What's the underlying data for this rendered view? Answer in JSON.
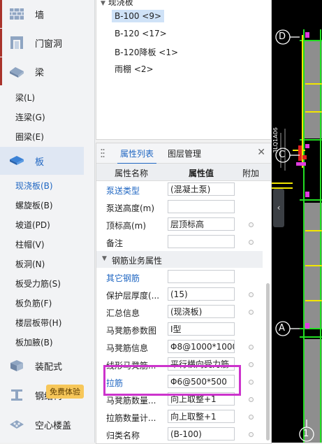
{
  "leftnav": {
    "categories": [
      {
        "label": "墙"
      },
      {
        "label": "门窗洞"
      },
      {
        "label": "梁"
      },
      {
        "label": "板"
      },
      {
        "label": "装配式"
      },
      {
        "label": "钢结构"
      },
      {
        "label": "空心楼盖"
      }
    ],
    "beam_items": [
      "梁(L)",
      "连梁(G)",
      "圈梁(E)"
    ],
    "slab_items": [
      "现浇板(B)",
      "螺旋板(B)",
      "坡道(PD)",
      "柱帽(V)",
      "板洞(N)",
      "板受力筋(S)",
      "板负筋(F)",
      "楼层板带(H)",
      "板加腋(B)"
    ],
    "badge": "免费体验"
  },
  "tree": {
    "root": "现浇板",
    "nodes": [
      "B-100 <9>",
      "B-120 <17>",
      "B-120降板 <1>",
      "雨棚 <2>"
    ]
  },
  "props": {
    "tab_props": "属性列表",
    "tab_layers": "图层管理",
    "close": "✕",
    "col_name": "属性名称",
    "col_value": "属性值",
    "col_add": "附加",
    "rows_top": [
      {
        "name": "泵送类型",
        "value": "(混凝土泵)",
        "link": true
      },
      {
        "name": "泵送高度(m)",
        "value": "",
        "link": false
      },
      {
        "name": "顶标高(m)",
        "value": "层顶标高",
        "link": false
      },
      {
        "name": "备注",
        "value": "",
        "link": false
      }
    ],
    "section": "钢筋业务属性",
    "rows_bottom": [
      {
        "name": "其它钢筋",
        "value": "",
        "link": true
      },
      {
        "name": "保护层厚度(...",
        "value": "(15)",
        "link": false
      },
      {
        "name": "汇总信息",
        "value": "(现浇板)",
        "link": false
      },
      {
        "name": "马凳筋参数图",
        "value": "Ⅰ型",
        "link": false
      },
      {
        "name": "马凳筋信息",
        "value": "Φ8@1000*1000",
        "link": false
      },
      {
        "name": "线形马凳筋...",
        "value": "平行横向受力筋",
        "link": false
      },
      {
        "name": "拉筋",
        "value": "Φ6@500*500",
        "link": true
      },
      {
        "name": "马凳筋数量...",
        "value": "向上取整+1",
        "link": false
      },
      {
        "name": "拉筋数量计...",
        "value": "向上取整+1",
        "link": false
      },
      {
        "name": "归类名称",
        "value": "(B-100)",
        "link": false
      }
    ]
  },
  "cad": {
    "axis_labels": [
      "D",
      "C",
      "A",
      "1"
    ],
    "dim_text": "3LQ1A06"
  }
}
